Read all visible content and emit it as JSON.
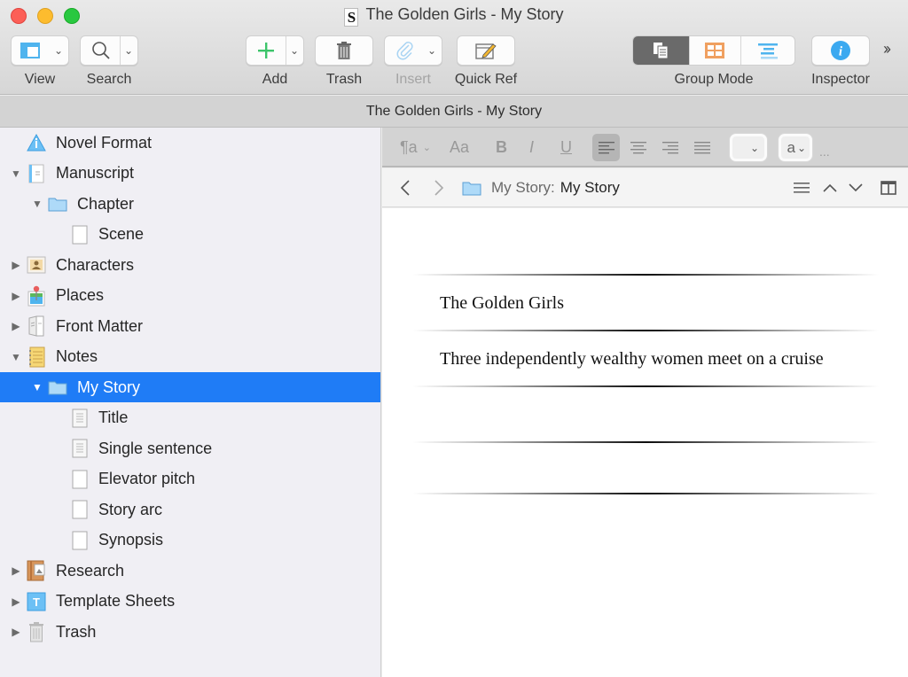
{
  "window": {
    "title": "The Golden Girls - My Story",
    "project_title": "The Golden Girls - My Story"
  },
  "toolbar": {
    "view": {
      "label": "View",
      "icon": "layout-view-icon"
    },
    "search": {
      "label": "Search",
      "icon": "magnifier-icon"
    },
    "add": {
      "label": "Add",
      "icon": "plus-icon"
    },
    "trash": {
      "label": "Trash",
      "icon": "trash-icon"
    },
    "insert": {
      "label": "Insert",
      "icon": "paperclip-icon",
      "disabled": true
    },
    "quick_ref": {
      "label": "Quick Ref",
      "icon": "quick-ref-icon"
    },
    "group_mode": {
      "label": "Group Mode",
      "modes": [
        "scrivenings",
        "corkboard",
        "outliner"
      ],
      "active": "scrivenings"
    },
    "inspector": {
      "label": "Inspector",
      "icon": "info-icon"
    },
    "overflow": "»"
  },
  "colors": {
    "selection": "#1f7cf6",
    "add_green": "#3cc46a",
    "corkboard_orange": "#f0a060",
    "outliner_blue": "#4fb4ee",
    "inspector_blue": "#3ba9f0"
  },
  "binder": {
    "items": [
      {
        "label": "Novel Format",
        "icon": "warning-info-icon",
        "level": 0,
        "disclosure": "none"
      },
      {
        "label": "Manuscript",
        "icon": "manuscript-icon",
        "level": 0,
        "disclosure": "expanded"
      },
      {
        "label": "Chapter",
        "icon": "folder-icon",
        "level": 1,
        "disclosure": "expanded"
      },
      {
        "label": "Scene",
        "icon": "blank-document-icon",
        "level": 2,
        "disclosure": "none"
      },
      {
        "label": "Characters",
        "icon": "character-icon",
        "level": 0,
        "disclosure": "collapsed"
      },
      {
        "label": "Places",
        "icon": "places-pin-icon",
        "level": 0,
        "disclosure": "collapsed"
      },
      {
        "label": "Front Matter",
        "icon": "front-matter-icon",
        "level": 0,
        "disclosure": "collapsed"
      },
      {
        "label": "Notes",
        "icon": "notepad-icon",
        "level": 0,
        "disclosure": "expanded"
      },
      {
        "label": "My Story",
        "icon": "folder-icon",
        "level": 1,
        "disclosure": "expanded",
        "selected": true
      },
      {
        "label": "Title",
        "icon": "text-document-icon",
        "level": 2,
        "disclosure": "none"
      },
      {
        "label": "Single sentence",
        "icon": "text-document-icon",
        "level": 2,
        "disclosure": "none"
      },
      {
        "label": "Elevator pitch",
        "icon": "blank-document-icon",
        "level": 2,
        "disclosure": "none"
      },
      {
        "label": "Story arc",
        "icon": "blank-document-icon",
        "level": 2,
        "disclosure": "none"
      },
      {
        "label": "Synopsis",
        "icon": "blank-document-icon",
        "level": 2,
        "disclosure": "none"
      },
      {
        "label": "Research",
        "icon": "research-icon",
        "level": 0,
        "disclosure": "collapsed"
      },
      {
        "label": "Template Sheets",
        "icon": "template-icon",
        "level": 0,
        "disclosure": "collapsed"
      },
      {
        "label": "Trash",
        "icon": "trash-icon",
        "level": 0,
        "disclosure": "collapsed"
      }
    ]
  },
  "format_bar": {
    "paragraph_style": "¶a",
    "fonts": "Aa",
    "bold": "B",
    "italic": "I",
    "underline": "U",
    "alignment_active": "left",
    "line_spacing_value": "",
    "highlight_value": "a",
    "more": "..."
  },
  "header_bar": {
    "back": "‹",
    "forward": "›",
    "path_prefix": "My Story:",
    "path_title": "My Story"
  },
  "editor": {
    "lines": [
      "The Golden Girls",
      "Three independently wealthy women meet on a cruise",
      "",
      ""
    ]
  }
}
